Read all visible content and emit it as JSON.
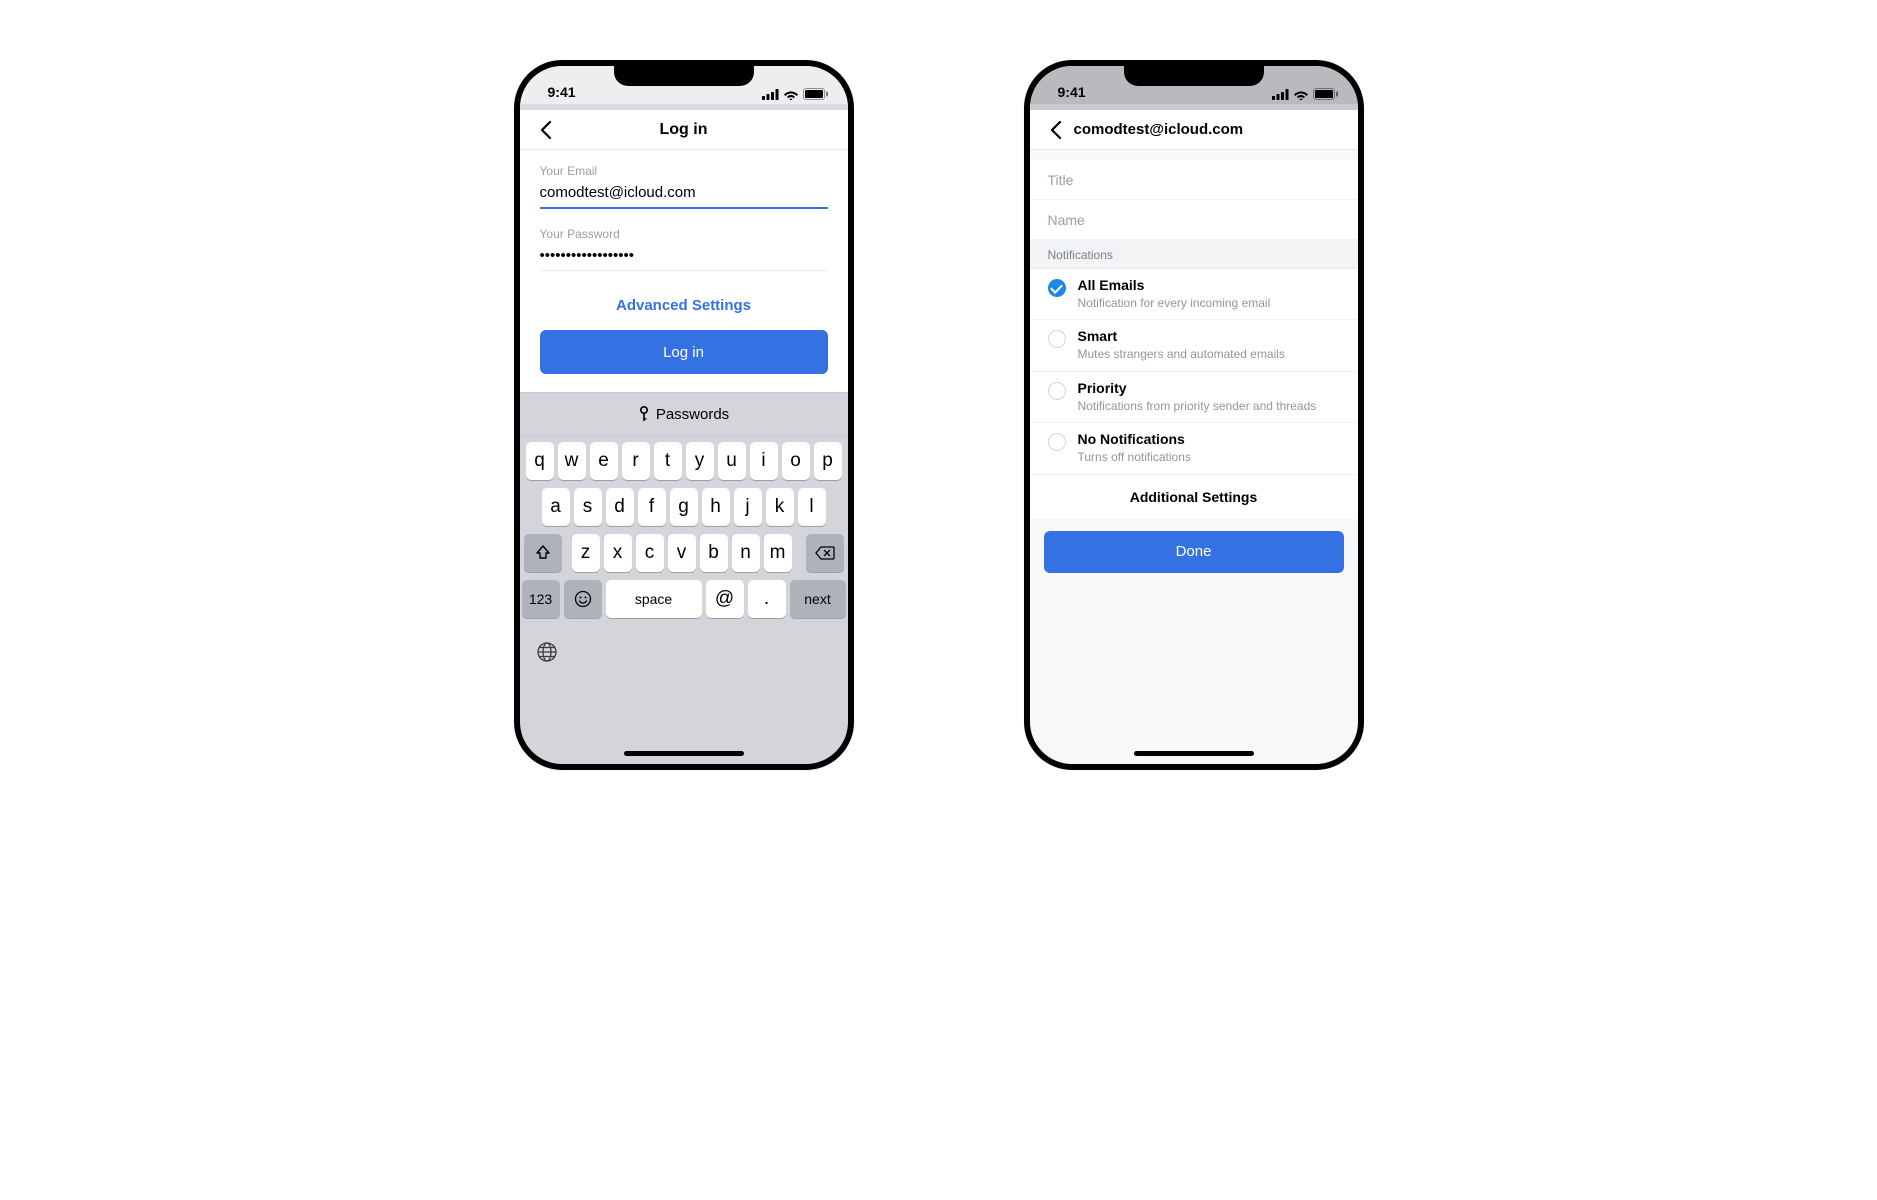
{
  "status": {
    "time": "9:41"
  },
  "login": {
    "title": "Log in",
    "email_label": "Your Email",
    "email_value": "comodtest@icloud.com",
    "password_label": "Your Password",
    "password_value": "••••••••••••••••••",
    "advanced": "Advanced Settings",
    "button": "Log in",
    "passwords_suggestion": "Passwords"
  },
  "keyboard": {
    "row1": [
      "q",
      "w",
      "e",
      "r",
      "t",
      "y",
      "u",
      "i",
      "o",
      "p"
    ],
    "row2": [
      "a",
      "s",
      "d",
      "f",
      "g",
      "h",
      "j",
      "k",
      "l"
    ],
    "row3_mid": [
      "z",
      "x",
      "c",
      "v",
      "b",
      "n",
      "m"
    ],
    "num": "123",
    "space": "space",
    "at": "@",
    "dot": ".",
    "next": "next"
  },
  "settings": {
    "title": "comodtest@icloud.com",
    "title_placeholder": "Title",
    "name_placeholder": "Name",
    "section": "Notifications",
    "options": [
      {
        "title": "All Emails",
        "sub": "Notification for every incoming email",
        "checked": true
      },
      {
        "title": "Smart",
        "sub": "Mutes strangers and automated emails",
        "checked": false
      },
      {
        "title": "Priority",
        "sub": "Notifications from priority sender and threads",
        "checked": false
      },
      {
        "title": "No Notifications",
        "sub": "Turns off notifications",
        "checked": false
      }
    ],
    "additional": "Additional Settings",
    "done": "Done"
  }
}
